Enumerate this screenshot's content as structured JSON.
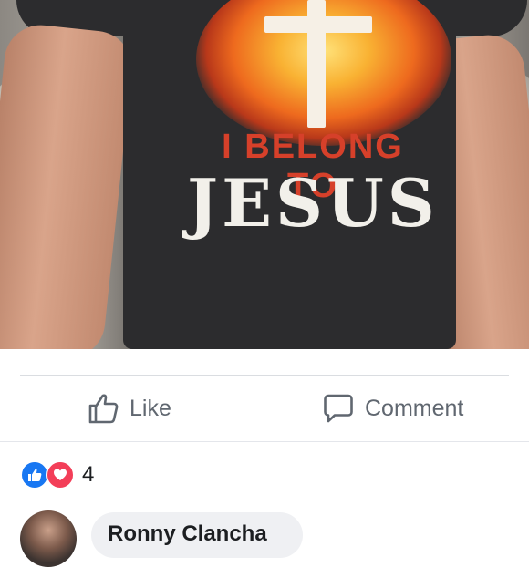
{
  "post": {
    "photo": {
      "shirt_text_line1": "I BELONG TO",
      "shirt_text_line2": "JESUS"
    }
  },
  "actions": {
    "like_label": "Like",
    "comment_label": "Comment"
  },
  "reactions": {
    "types": [
      "like-icon",
      "love-icon"
    ],
    "count": "4",
    "colors": {
      "like": "#1877f2",
      "love": "#f33e58"
    }
  },
  "comment_preview": {
    "author": "Ronny Clancha"
  }
}
